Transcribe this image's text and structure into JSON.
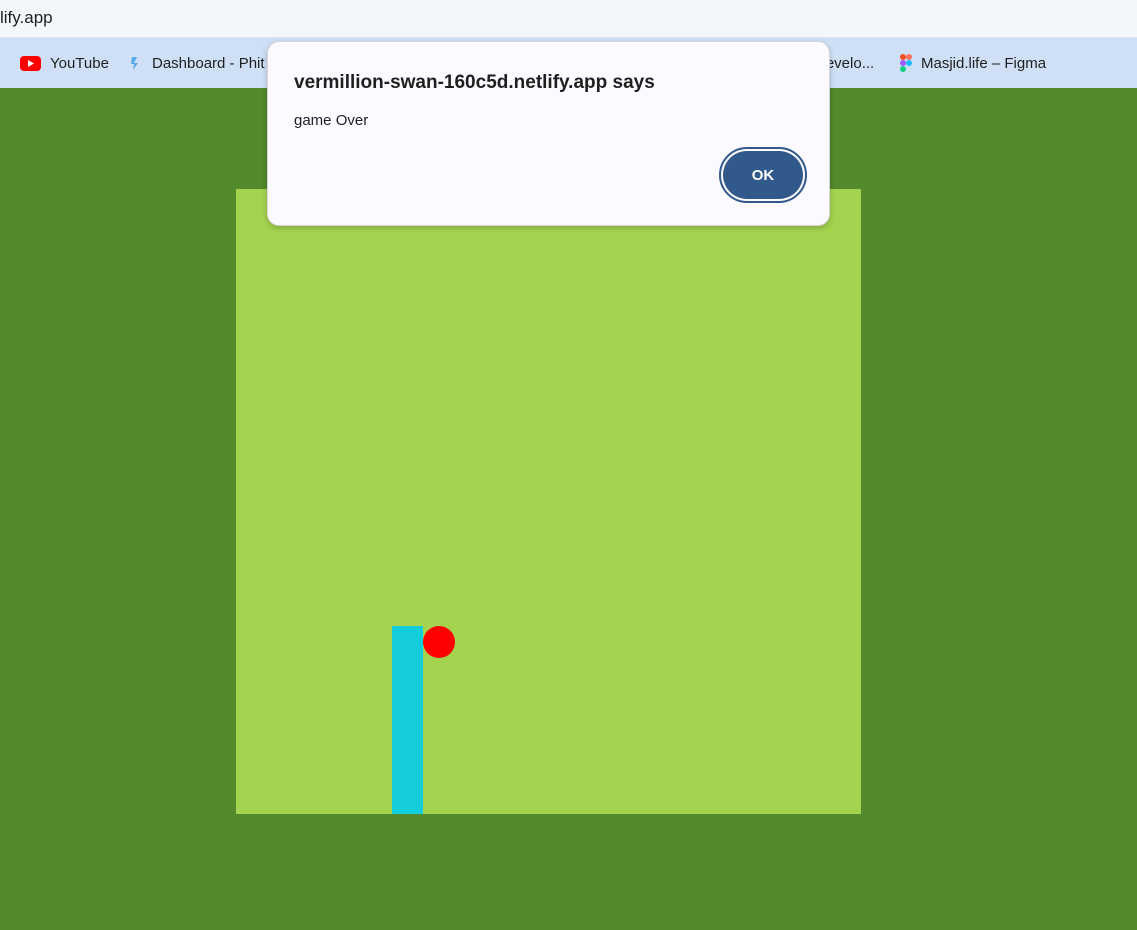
{
  "browser": {
    "address_text": "lify.app",
    "bookmarks": [
      {
        "label": "YouTube",
        "icon": "youtube-icon"
      },
      {
        "label": "Dashboard - Phit",
        "icon": "dashboard-icon"
      },
      {
        "label": "Develo...",
        "icon": ""
      },
      {
        "label": "Masjid.life – Figma",
        "icon": "figma-icon"
      }
    ]
  },
  "dialog": {
    "title": "vermillion-swan-160c5d.netlify.app says",
    "message": "game Over",
    "ok_label": "OK"
  },
  "colors": {
    "page_background": "#528a2c",
    "board": "#a4d34f",
    "pillar": "#13cddb",
    "ball": "#ff0000",
    "ok_button": "#32598c"
  }
}
